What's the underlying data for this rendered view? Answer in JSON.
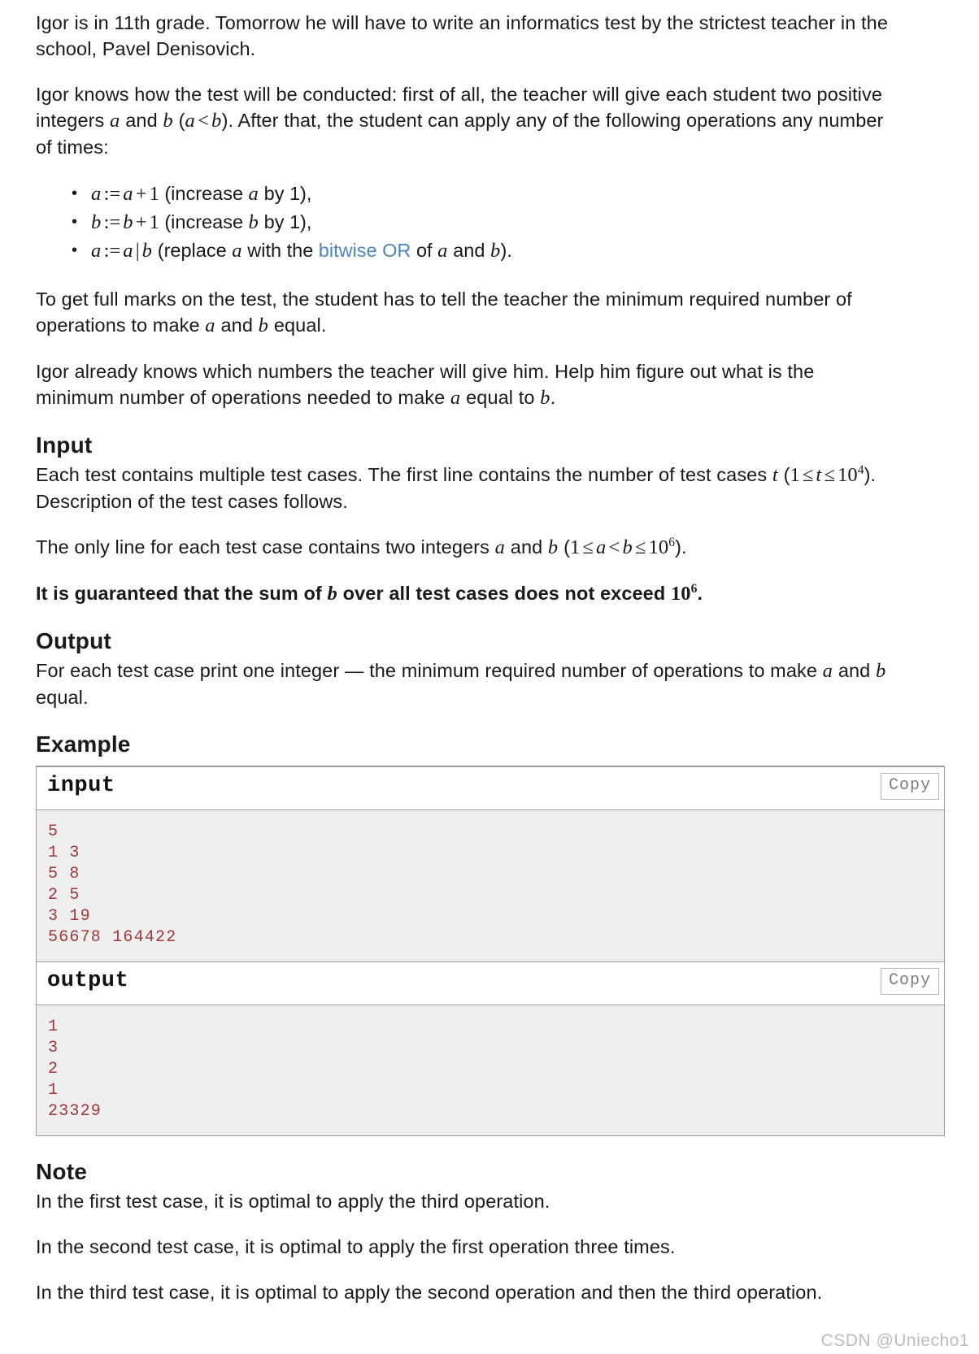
{
  "document": {
    "intro_paragraph": "Igor is in 11th grade. Tomorrow he will have to write an informatics test by the strictest teacher in the school, Pavel Denisovich.",
    "setup_paragraph_part1": "Igor knows how the test will be conducted: first of all, the teacher will give each student two positive integers ",
    "setup_paragraph_part2": " and ",
    "setup_paragraph_part3": " (",
    "setup_paragraph_part4": "). After that, the student can apply any of the following operations any number of times:",
    "operations": [
      {
        "formula_lhs": "a",
        "assign": ":=",
        "formula_rhs_var": "a",
        "formula_rhs_op": "+",
        "formula_rhs_num": "1",
        "description_pre": " (increase ",
        "description_var": "a",
        "description_post": " by 1),"
      },
      {
        "formula_lhs": "b",
        "assign": ":=",
        "formula_rhs_var": "b",
        "formula_rhs_op": "+",
        "formula_rhs_num": "1",
        "description_pre": " (increase ",
        "description_var": "b",
        "description_post": " by 1),"
      },
      {
        "formula_lhs": "a",
        "assign": ":=",
        "formula_rhs_var": "a",
        "formula_rhs_op": "|",
        "formula_rhs_num": "b",
        "description_pre": " (replace ",
        "description_var": "a",
        "description_mid": " with the ",
        "link_text": "bitwise OR",
        "description_mid2": " of ",
        "description_var2": "a",
        "description_mid3": " and ",
        "description_var3": "b",
        "description_post": ")."
      }
    ],
    "full_marks_paragraph_pre": "To get full marks on the test, the student has to tell the teacher the minimum required number of operations to make ",
    "full_marks_paragraph_mid": " and ",
    "full_marks_paragraph_post": " equal.",
    "help_paragraph_pre": "Igor already knows which numbers the teacher will give him. Help him figure out what is the minimum number of operations needed to make ",
    "help_paragraph_mid": " equal to ",
    "help_paragraph_post": ".",
    "sections": {
      "input": {
        "heading": "Input",
        "p1_pre": "Each test contains multiple test cases. The first line contains the number of test cases ",
        "p1_var": "t",
        "p1_open": " (",
        "p1_constraint_a": "1",
        "p1_le1": "≤",
        "p1_constraint_t": "t",
        "p1_le2": "≤",
        "p1_constraint_b": "10",
        "p1_exp": "4",
        "p1_post": "). Description of the test cases follows.",
        "p2_pre": "The only line for each test case contains two integers ",
        "p2_var_a": "a",
        "p2_and": " and ",
        "p2_var_b": "b",
        "p2_open": " (",
        "p2_one": "1",
        "p2_le": "≤",
        "p2_a": "a",
        "p2_lt": "<",
        "p2_b": "b",
        "p2_le2": "≤",
        "p2_ten": "10",
        "p2_exp": "6",
        "p2_close": ").",
        "guarantee_pre": "It is guaranteed that the sum of ",
        "guarantee_var": "b",
        "guarantee_mid": " over all test cases does not exceed ",
        "guarantee_ten": "10",
        "guarantee_exp": "6",
        "guarantee_post": "."
      },
      "output": {
        "heading": "Output",
        "p1_pre": "For each test case print one integer — the minimum required number of operations to make ",
        "p1_var_a": "a",
        "p1_and": " and ",
        "p1_var_b": "b",
        "p1_post": " equal."
      },
      "example": {
        "heading": "Example",
        "input_label": "input",
        "output_label": "output",
        "copy_label": "Copy",
        "input_text": "5\n1 3\n5 8\n2 5\n3 19\n56678 164422",
        "output_text": "1\n3\n2\n1\n23329"
      },
      "note": {
        "heading": "Note",
        "items": [
          "In the first test case, it is optimal to apply the third operation.",
          "In the second test case, it is optimal to apply the first operation three times.",
          "In the third test case, it is optimal to apply the second operation and then the third operation."
        ]
      }
    },
    "watermark": "CSDN @Uniecho1",
    "colors": {
      "link": "#4b86c2",
      "code_text": "#a03a3a",
      "code_bg": "#efefef",
      "border": "#9b9b9b",
      "text": "#1a1a1a"
    }
  }
}
